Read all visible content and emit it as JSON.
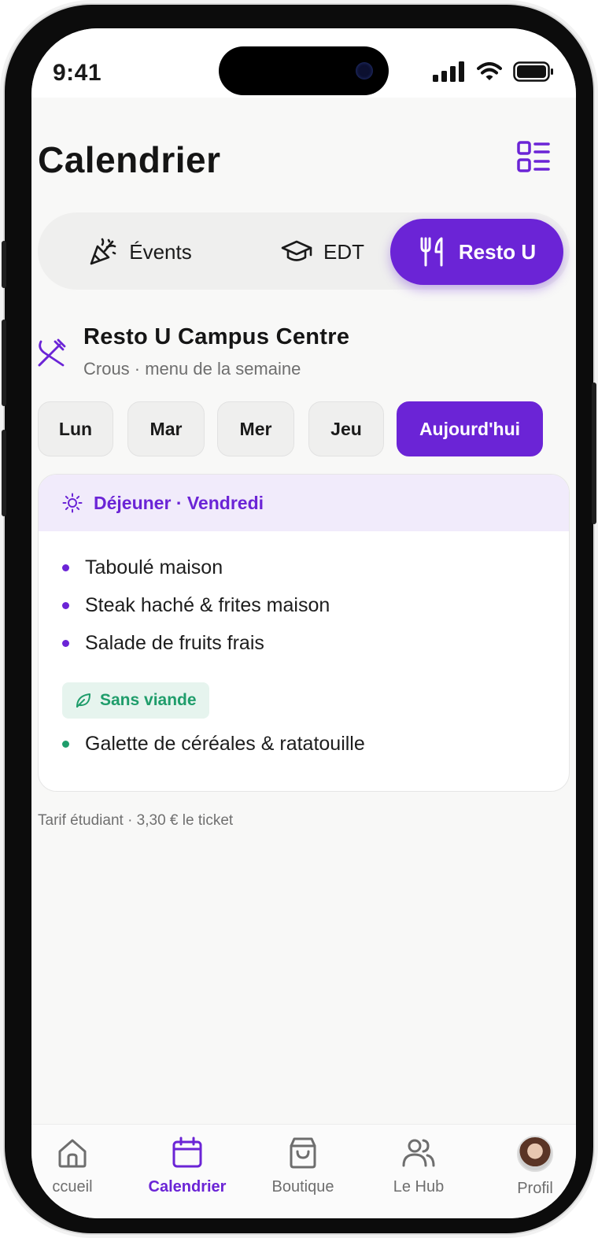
{
  "status": {
    "time": "9:41"
  },
  "page": {
    "title": "Calendrier"
  },
  "segments": [
    {
      "label": "Évents",
      "icon": "party-popper-icon"
    },
    {
      "label": "EDT",
      "icon": "graduation-cap-icon"
    },
    {
      "label": "Resto U",
      "icon": "fork-knife-icon",
      "active": true
    }
  ],
  "restaurant": {
    "name": "Resto U Campus Centre",
    "subtitle": "Crous · menu de la semaine"
  },
  "days": [
    {
      "label": "Lun"
    },
    {
      "label": "Mar"
    },
    {
      "label": "Mer"
    },
    {
      "label": "Jeu"
    },
    {
      "label": "Aujourd'hui",
      "active": true
    }
  ],
  "menu": {
    "header": "Déjeuner · Vendredi",
    "dishes": [
      "Taboulé maison",
      "Steak haché & frites maison",
      "Salade de fruits frais"
    ],
    "veg_badge": "Sans viande",
    "veg_dishes": [
      "Galette de céréales & ratatouille"
    ]
  },
  "tarif": "Tarif étudiant · 3,30 € le ticket",
  "tabbar": {
    "items": [
      {
        "label": "ccueil",
        "icon": "home-icon"
      },
      {
        "label": "Calendrier",
        "icon": "calendar-icon",
        "active": true
      },
      {
        "label": "Boutique",
        "icon": "shopping-bag-icon"
      },
      {
        "label": "Le Hub",
        "icon": "users-icon"
      },
      {
        "label": "Profil",
        "icon": "avatar"
      }
    ]
  },
  "colors": {
    "accent": "#6b24d6",
    "veg": "#1f9d6b",
    "background": "#f8f8f7"
  }
}
